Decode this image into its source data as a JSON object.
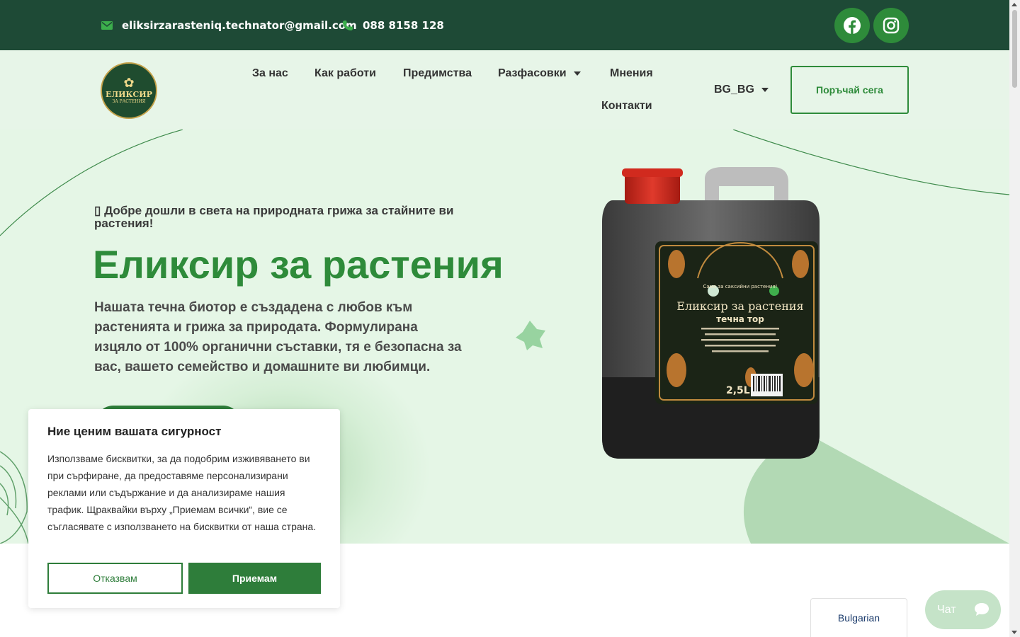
{
  "topbar": {
    "email": "eliksirzarasteniq.technator@gmail.com",
    "phone": "088 8158 128",
    "social": [
      {
        "name": "facebook-icon"
      },
      {
        "name": "instagram-icon"
      }
    ]
  },
  "header": {
    "logo": {
      "line1": "ЕЛИКСИР",
      "line2": "ЗА РАСТЕНИЯ"
    },
    "nav": {
      "about": "За нас",
      "how": "Как работи",
      "benefits": "Предимства",
      "packaging": "Разфасовки",
      "reviews": "Мнения",
      "contacts": "Контакти"
    },
    "language": "BG_BG",
    "order_button": "Поръчай сега"
  },
  "hero": {
    "tagline": "▯ Добре дошли в света на природната грижа за стайните ви растения!",
    "title": "Еликсир за растения",
    "description": "Нашата течна биотор е създадена с любов към растенията и грижа за природата. Формулирана изцяло от 100% органични съставки, тя е безопасна за вас, вашето семейство и домашните ви любимци."
  },
  "product_label": {
    "badge": "Само за саксийни растения!",
    "title": "Еликсир за растения",
    "subtitle": "течна тор",
    "volume": "2,5L"
  },
  "cookie": {
    "title": "Ние ценим вашата сигурност",
    "text": "Използваме бисквитки, за да подобрим изживяването ви при сърфиране, да предоставяме персонализирани реклами или съдържание и да анализираме нашия трафик. Щраквайки върху „Приемам всички“, вие се съгласявате с използването на бисквитки от наша страна.",
    "reject": "Отказвам",
    "accept": "Приемам"
  },
  "language_switcher": "Bulgarian",
  "chat": {
    "label": "Чат"
  },
  "colors": {
    "topbar": "#1e4a36",
    "accent": "#2e8b3a",
    "hero_bg": "#e5f6e6",
    "button_dark": "#2e7d3a"
  }
}
